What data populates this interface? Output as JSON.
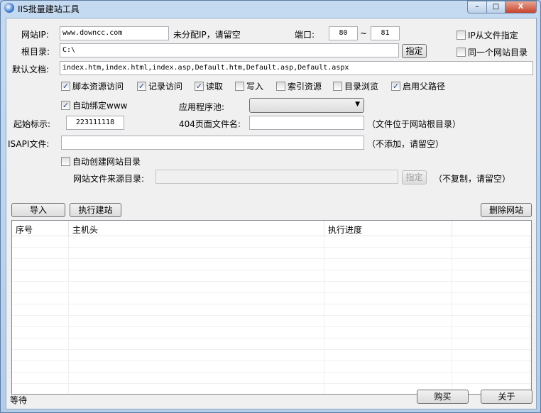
{
  "window": {
    "title": "IIS批量建站工具",
    "min": "–",
    "max": "□",
    "close": "X"
  },
  "form": {
    "ip_label": "网站IP:",
    "ip_value": "www.downcc.com",
    "ip_hint": "未分配IP，请留空",
    "port_label": "端口:",
    "port_from": "80",
    "port_sep": "~",
    "port_to": "81",
    "ip_from_file": "IP从文件指定",
    "same_dir": "同一个网站目录",
    "root_label": "根目录:",
    "root_value": "C:\\",
    "browse": "指定",
    "default_doc_label": "默认文档:",
    "default_doc_value": "index.htm,index.html,index.asp,Default.htm,Default.asp,Default.aspx",
    "perms": [
      {
        "label": "脚本资源访问",
        "checked": true
      },
      {
        "label": "记录访问",
        "checked": true
      },
      {
        "label": "读取",
        "checked": true
      },
      {
        "label": "写入",
        "checked": false
      },
      {
        "label": "索引资源",
        "checked": false
      },
      {
        "label": "目录浏览",
        "checked": false
      },
      {
        "label": "启用父路径",
        "checked": true
      }
    ],
    "auto_www": "自动绑定www",
    "app_pool_label": "应用程序池:",
    "app_pool_value": "",
    "start_label": "起始标示:",
    "start_value": "223111118",
    "page404_label": "404页面文件名:",
    "page404_value": "",
    "page404_hint": "（文件位于网站根目录）",
    "isapi_label": "ISAPI文件:",
    "isapi_value": "",
    "isapi_hint": "（不添加，请留空）",
    "auto_create": "自动创建网站目录",
    "source_label": "网站文件来源目录:",
    "source_value": "",
    "source_browse": "指定",
    "source_hint": "（不复制，请留空）"
  },
  "actions": {
    "import": "导入",
    "run": "执行建站",
    "delete": "删除网站"
  },
  "table": {
    "columns": [
      "序号",
      "主机头",
      "执行进度",
      ""
    ],
    "rows": []
  },
  "status": "等待",
  "footer": {
    "buy": "购买",
    "about": "关于"
  }
}
